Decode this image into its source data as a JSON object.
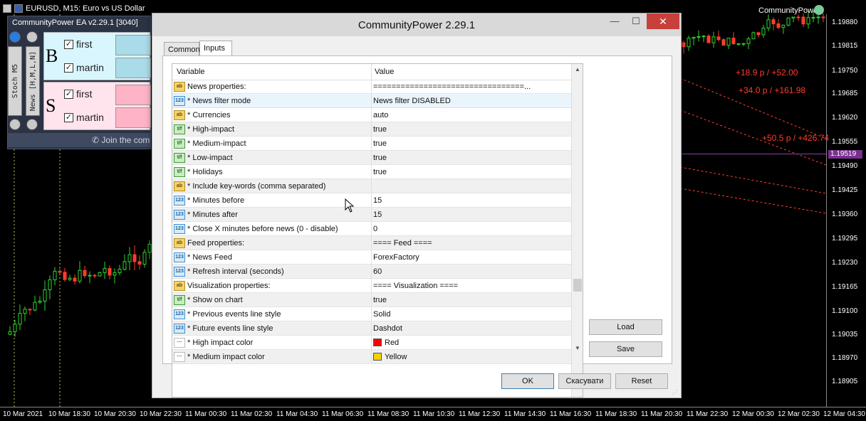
{
  "chart": {
    "title": "EURUSD, M15:  Euro vs US Dollar",
    "ea_label": "CommunityPower",
    "prices": [
      "1.19880",
      "1.19815",
      "1.19750",
      "1.19685",
      "1.19620",
      "1.19555",
      "1.19519",
      "1.19490",
      "1.19425",
      "1.19360",
      "1.19295",
      "1.19230",
      "1.19165",
      "1.19100",
      "1.19035",
      "1.18970",
      "1.18905"
    ],
    "current_price": "1.19519",
    "profit_labels": [
      "+18.9 p / +52.00",
      "+34.0 p / +161.98",
      "+50.5 p / +426.74"
    ],
    "times": [
      "10 Mar 2021",
      "10 Mar 18:30",
      "10 Mar 20:30",
      "10 Mar 22:30",
      "11 Mar 00:30",
      "11 Mar 02:30",
      "11 Mar 04:30",
      "11 Mar 06:30",
      "11 Mar 08:30",
      "11 Mar 10:30",
      "11 Mar 12:30",
      "11 Mar 14:30",
      "11 Mar 16:30",
      "11 Mar 18:30",
      "11 Mar 20:30",
      "11 Mar 22:30",
      "12 Mar 00:30",
      "12 Mar 02:30",
      "12 Mar 04:30"
    ],
    "colors": {
      "bull": "#2fd32f",
      "bear": "#ff3c2e",
      "purple": "#8a3fae"
    }
  },
  "ea_panel": {
    "header": "CommunityPower EA v2.29.1 [3040]",
    "left_button": "Stoch M5",
    "right_button": "News [H,M,L,N]",
    "buy": {
      "letter": "B",
      "first": "first",
      "martin": "martin",
      "checked": "✓"
    },
    "sell": {
      "letter": "S",
      "first": "first",
      "martin": "martin",
      "checked": "✓"
    },
    "join": "Join the com",
    "colors": {
      "buy_bg": "#d9f6ff",
      "buy_swatch": "#a9dbe8",
      "sell_bg": "#ffe4ee",
      "sell_swatch": "#ffb3c6"
    }
  },
  "dialog": {
    "title": "CommunityPower 2.29.1",
    "tabs": [
      "Common",
      "Inputs"
    ],
    "columns": {
      "variable": "Variable",
      "value": "Value"
    },
    "rows": [
      {
        "icon": "ab",
        "variable": "News properties:",
        "value": "=================================..."
      },
      {
        "icon": "123",
        "variable": "* News filter mode",
        "value": "News filter DISABLED"
      },
      {
        "icon": "ab",
        "variable": "* Currencies",
        "value": "auto"
      },
      {
        "icon": "bool",
        "variable": "* High-impact",
        "value": "true"
      },
      {
        "icon": "bool",
        "variable": "* Medium-impact",
        "value": "true"
      },
      {
        "icon": "bool",
        "variable": "* Low-impact",
        "value": "true"
      },
      {
        "icon": "bool",
        "variable": "* Holidays",
        "value": "true"
      },
      {
        "icon": "ab",
        "variable": "* Include key-words (comma separated)",
        "value": ""
      },
      {
        "icon": "123",
        "variable": "* Minutes before",
        "value": "15"
      },
      {
        "icon": "123",
        "variable": "* Minutes after",
        "value": "15"
      },
      {
        "icon": "123",
        "variable": "* Close X minutes before news (0 - disable)",
        "value": "0"
      },
      {
        "icon": "ab",
        "variable": "Feed properties:",
        "value": "==== Feed ===="
      },
      {
        "icon": "123",
        "variable": "* News Feed",
        "value": "ForexFactory"
      },
      {
        "icon": "123",
        "variable": "* Refresh interval (seconds)",
        "value": "60"
      },
      {
        "icon": "ab",
        "variable": "Visualization properties:",
        "value": "==== Visualization ===="
      },
      {
        "icon": "bool",
        "variable": "* Show on chart",
        "value": "true"
      },
      {
        "icon": "123",
        "variable": "* Previous events line style",
        "value": "Solid"
      },
      {
        "icon": "123",
        "variable": "* Future events line style",
        "value": "Dashdot"
      },
      {
        "icon": "clr",
        "variable": "* High impact color",
        "value": "Red",
        "swatch": "#ff0000"
      },
      {
        "icon": "clr",
        "variable": "* Medium impact color",
        "value": "Yellow",
        "swatch": "#f2d20a"
      }
    ],
    "side_buttons": {
      "load": "Load",
      "save": "Save"
    },
    "footer_buttons": {
      "ok": "OK",
      "cancel": "Скасувати",
      "reset": "Reset"
    },
    "window_buttons": {
      "min": "—",
      "max": "☐",
      "close": "✕"
    }
  }
}
